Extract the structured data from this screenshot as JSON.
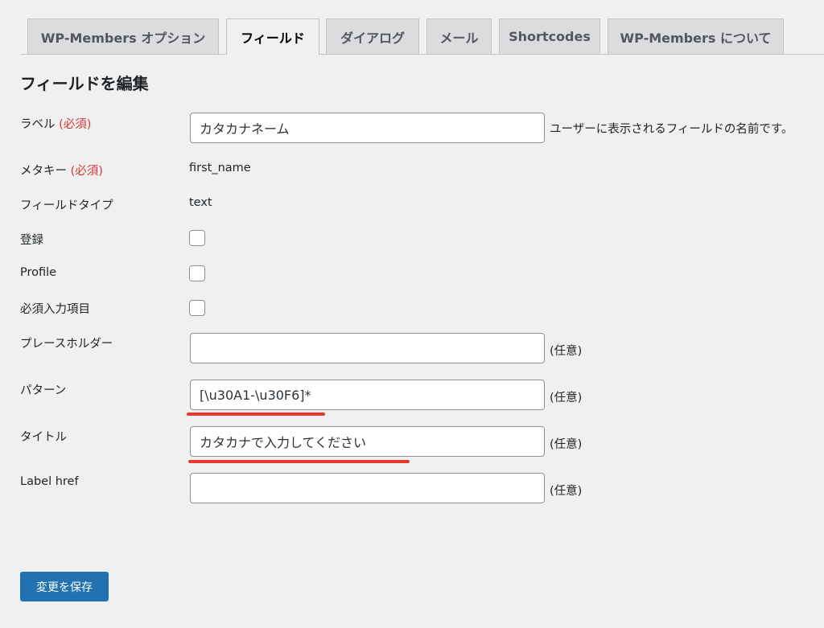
{
  "tabs": [
    {
      "label": "WP-Members オプション",
      "active": false
    },
    {
      "label": "フィールド",
      "active": true
    },
    {
      "label": "ダイアログ",
      "active": false
    },
    {
      "label": "メール",
      "active": false
    },
    {
      "label": "Shortcodes",
      "active": false
    },
    {
      "label": "WP-Members について",
      "active": false
    }
  ],
  "heading": "フィールドを編集",
  "required_text": "(必須)",
  "optional_text": "(任意)",
  "fields": {
    "label": {
      "label": "ラベル",
      "value": "カタカナネーム",
      "description": "ユーザーに表示されるフィールドの名前です。"
    },
    "meta_key": {
      "label": "メタキー",
      "value": "first_name"
    },
    "field_type": {
      "label": "フィールドタイプ",
      "value": "text"
    },
    "register": {
      "label": "登録",
      "checked": false
    },
    "profile": {
      "label": "Profile",
      "checked": false
    },
    "required": {
      "label": "必須入力項目",
      "checked": false
    },
    "placeholder": {
      "label": "プレースホルダー",
      "value": ""
    },
    "pattern": {
      "label": "パターン",
      "value": "[\\u30A1-\\u30F6]*"
    },
    "title": {
      "label": "タイトル",
      "value": "カタカナで入力してください"
    },
    "label_href": {
      "label": "Label href",
      "value": ""
    }
  },
  "save_button": "変更を保存",
  "colors": {
    "accent": "#2271b1",
    "required": "#d63638",
    "annotation_underline": "#e8382a"
  }
}
